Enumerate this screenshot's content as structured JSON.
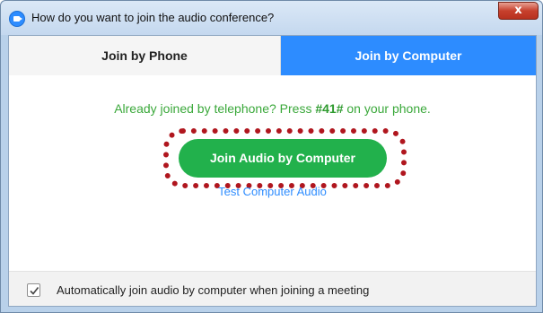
{
  "window": {
    "title": "How do you want to join the audio conference?",
    "close_glyph": "x",
    "app_icon": "zoom-logo-icon"
  },
  "tabs": [
    {
      "label": "Join by Phone",
      "selected": false
    },
    {
      "label": "Join by Computer",
      "selected": true
    }
  ],
  "main": {
    "already_prefix": "Already joined by telephone? Press ",
    "code": "#41#",
    "already_suffix": " on your phone.",
    "join_button": "Join Audio by Computer",
    "test_link": "Test Computer Audio"
  },
  "footer": {
    "auto_join_checked": true,
    "auto_join_label": "Automatically join audio by computer when joining a meeting"
  },
  "colors": {
    "accent": "#2d8cff",
    "join_green": "#22b14c",
    "highlight": "#b0161e"
  }
}
